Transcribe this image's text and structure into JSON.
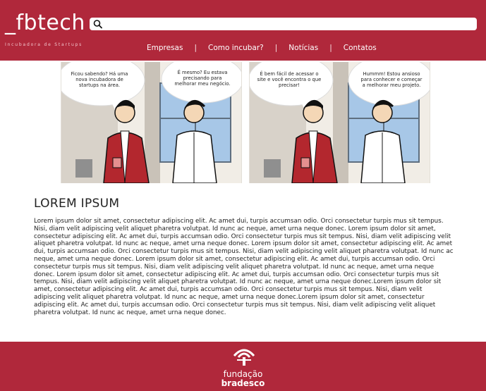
{
  "brand": {
    "logo": "_fbtech",
    "tagline": "Incubadora de Startups",
    "primary_color": "#b0283b"
  },
  "search": {
    "icon": "search-icon",
    "placeholder": ""
  },
  "nav": {
    "items": [
      {
        "label": "Empresas"
      },
      {
        "label": "Como incubar?"
      },
      {
        "label": "Notícias"
      },
      {
        "label": "Contatos"
      }
    ],
    "separator": "|"
  },
  "comic": {
    "panels": [
      {
        "left_bubble": "Ficou sabendo? Há uma nova incubadora de startups na área.",
        "right_bubble": "É mesmo? Eu estava precisando para melhorar meu negócio."
      },
      {
        "left_bubble": "É bem fácil de acessar o site e você encontra o que precisar!",
        "right_bubble": "Hummm! Estou ansioso para conhecer e começar a melhorar meu projeto."
      }
    ]
  },
  "article": {
    "title": "LOREM IPSUM",
    "body": "Lorem ipsum dolor sit amet, consectetur adipiscing elit. Ac amet dui, turpis accumsan odio. Orci consectetur turpis mus sit tempus. Nisi, diam velit adipiscing velit aliquet pharetra volutpat. Id nunc ac neque, amet urna neque donec. Lorem ipsum dolor sit amet, consectetur adipiscing elit. Ac amet dui, turpis accumsan odio. Orci consectetur turpis mus sit tempus. Nisi, diam velit adipiscing velit aliquet pharetra volutpat. Id nunc ac neque, amet urna neque donec. Lorem ipsum dolor sit amet, consectetur adipiscing elit. Ac amet dui, turpis accumsan odio. Orci consectetur turpis mus sit tempus. Nisi, diam velit adipiscing velit aliquet pharetra volutpat. Id nunc ac neque, amet urna neque donec. Lorem ipsum dolor sit amet, consectetur adipiscing elit. Ac amet dui, turpis accumsan odio. Orci consectetur turpis mus sit tempus. Nisi, diam velit adipiscing velit aliquet pharetra volutpat. Id nunc ac neque, amet urna neque donec. Lorem ipsum dolor sit amet, consectetur adipiscing elit. Ac amet dui, turpis accumsan odio. Orci consectetur turpis mus sit tempus. Nisi, diam velit adipiscing velit aliquet pharetra volutpat. Id nunc ac neque, amet urna neque donec.Lorem ipsum dolor sit amet, consectetur adipiscing elit. Ac amet dui, turpis accumsan odio. Orci consectetur turpis mus sit tempus. Nisi, diam velit adipiscing velit aliquet pharetra volutpat. Id nunc ac neque, amet urna neque donec.Lorem ipsum dolor sit amet, consectetur adipiscing elit. Ac amet dui, turpis accumsan odio. Orci consectetur turpis mus sit tempus. Nisi, diam velit adipiscing velit aliquet pharetra volutpat. Id nunc ac neque, amet urna neque donec."
  },
  "footer": {
    "logo_icon": "fundacao-bradesco-logo",
    "line1": "fundação",
    "line2": "bradesco"
  }
}
